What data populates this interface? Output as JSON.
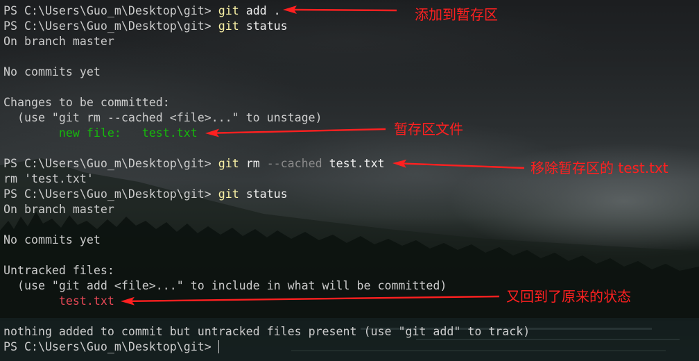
{
  "terminal": {
    "prompt": "PS C:\\Users\\Guo_m\\Desktop\\git>",
    "commands": [
      {
        "program": "git",
        "args": "add ."
      },
      {
        "program": "git",
        "args": "status"
      },
      {
        "program": "git",
        "subcommand": "rm",
        "flag": "--cached",
        "target": "test.txt"
      },
      {
        "program": "git",
        "args": "status"
      }
    ],
    "status_before": {
      "branch": "On branch master",
      "commits": "No commits yet",
      "section_header": "Changes to be committed:",
      "hint": "(use \"git rm --cached <file>...\" to unstage)",
      "entry": "new file:   test.txt"
    },
    "rm_output": "rm 'test.txt'",
    "status_after": {
      "branch": "On branch master",
      "commits": "No commits yet",
      "section_header": "Untracked files:",
      "hint": "(use \"git add <file>...\" to include in what will be committed)",
      "entry": "test.txt",
      "summary": "nothing added to commit but untracked files present (use \"git add\" to track)"
    }
  },
  "annotations": [
    {
      "text": "添加到暂存区"
    },
    {
      "text": "暂存区文件"
    },
    {
      "text": "移除暂存区的 test.txt"
    },
    {
      "text": "又回到了原来的状态"
    }
  ],
  "colors": {
    "foreground": "#cccccc",
    "command": "#f9f1a5",
    "argument": "#eeeeee",
    "parameter": "#8a8a8a",
    "staged_file": "#16b80c",
    "untracked_file": "#e74856",
    "annotation": "#ff2020"
  }
}
